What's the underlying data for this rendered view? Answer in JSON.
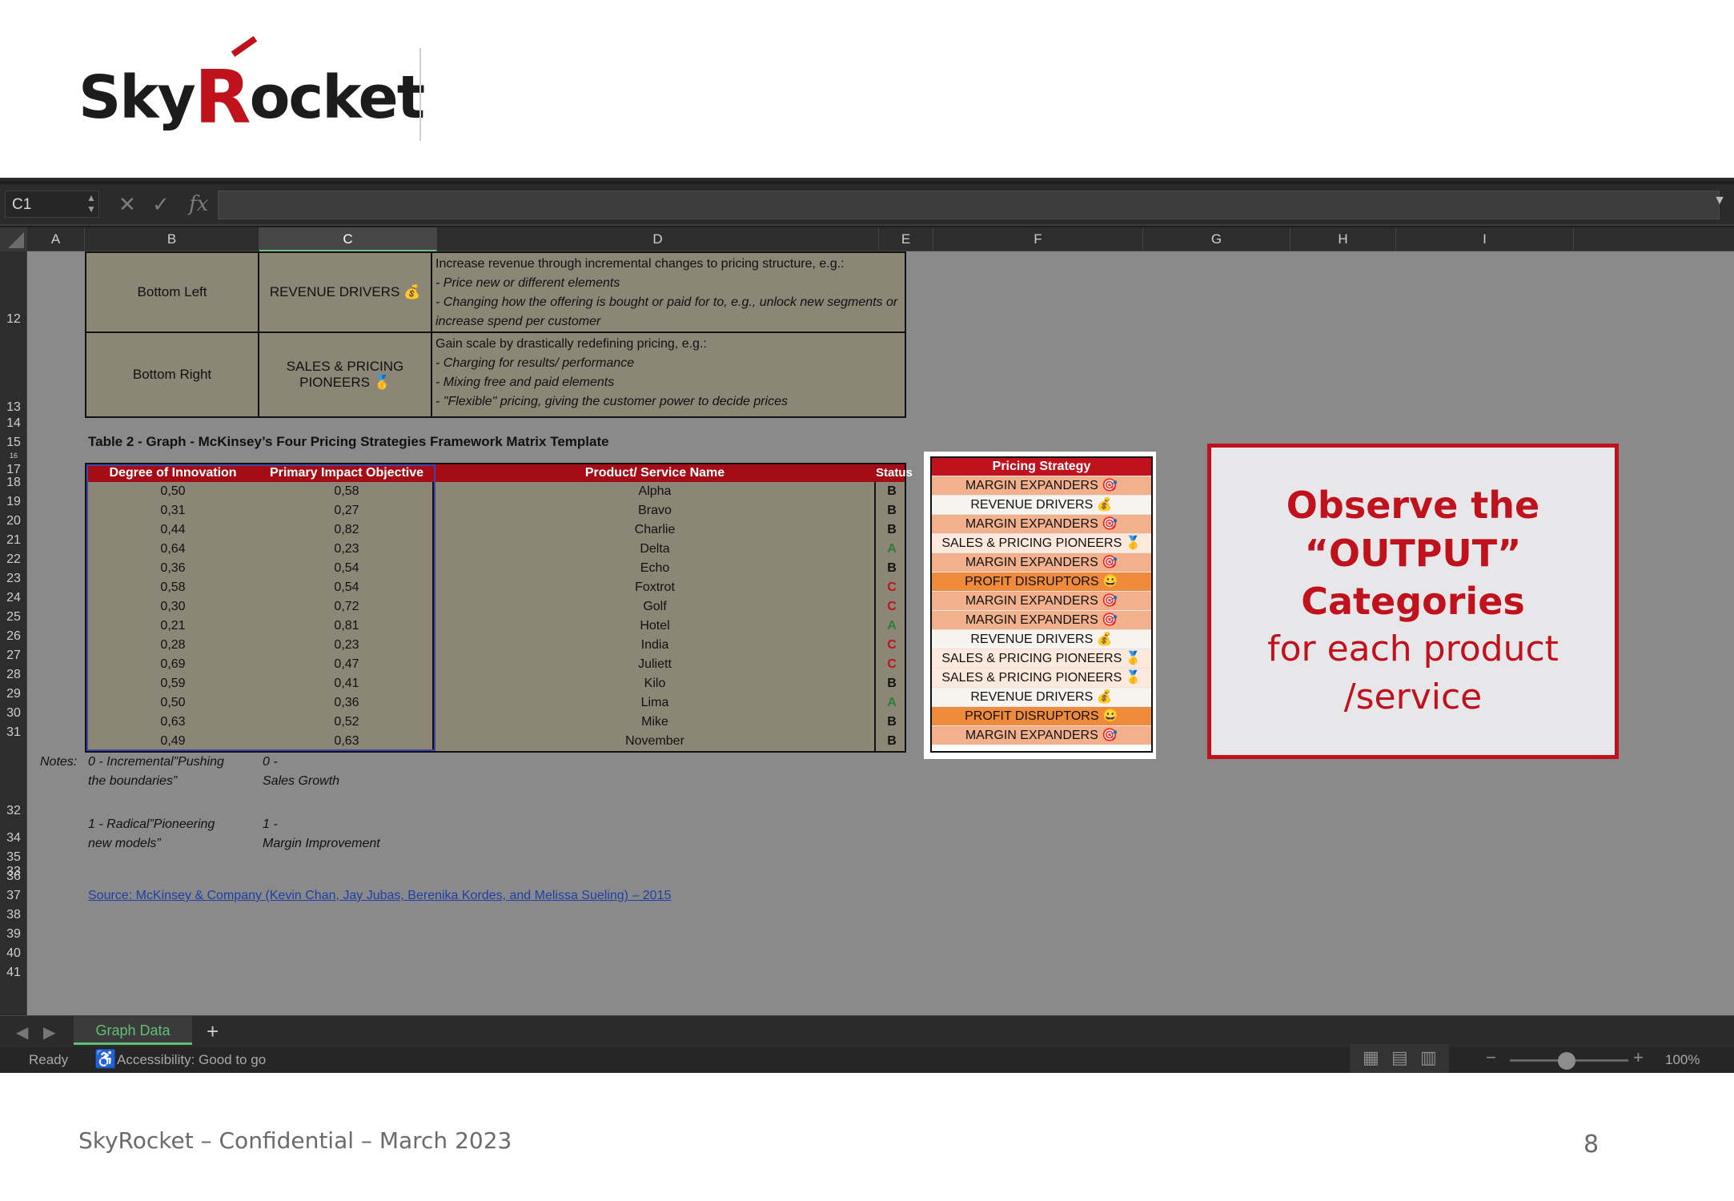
{
  "logo": {
    "part1": "Sky",
    "part2": "R",
    "part3": "ocket"
  },
  "excel": {
    "name_box": "C1",
    "columns": [
      "A",
      "B",
      "C",
      "D",
      "E",
      "F",
      "G",
      "H",
      "I"
    ],
    "rows": [
      "12",
      "13",
      "14",
      "15",
      "16",
      "17",
      "18",
      "19",
      "20",
      "21",
      "22",
      "23",
      "24",
      "25",
      "26",
      "27",
      "28",
      "29",
      "30",
      "31",
      "32",
      "33",
      "34",
      "35",
      "36",
      "37",
      "38",
      "39",
      "40",
      "41"
    ],
    "upper_rows": [
      {
        "position": "Bottom Left",
        "strategy": "REVENUE DRIVERS 💰",
        "desc_lead": "Increase revenue through incremental changes to pricing structure, e.g.:",
        "desc_items": [
          "- Price new or different elements",
          "- Changing how the offering is bought or paid for to, e.g., unlock new segments or increase spend per customer"
        ]
      },
      {
        "position": "Bottom Right",
        "strategy": "SALES & PRICING PIONEERS 🥇",
        "desc_lead": "Gain scale by drastically redefining pricing, e.g.:",
        "desc_items": [
          "- Charging for results/ performance",
          "- Mixing free and paid elements",
          "- \"Flexible\" pricing, giving the customer power to decide prices"
        ]
      }
    ],
    "table2_title": "Table 2 - Graph - McKinsey’s Four Pricing Strategies Framework Matrix Template",
    "headers": {
      "degree": "Degree of Innovation",
      "impact": "Primary Impact Objective",
      "name": "Product/ Service Name",
      "status": "Status",
      "strategy": "Pricing Strategy"
    },
    "data_rows": [
      {
        "degree": "0,50",
        "impact": "0,58",
        "name": "Alpha",
        "status": "B",
        "strategy": "MARGIN EXPANDERS 🎯"
      },
      {
        "degree": "0,31",
        "impact": "0,27",
        "name": "Bravo",
        "status": "B",
        "strategy": "REVENUE DRIVERS 💰"
      },
      {
        "degree": "0,44",
        "impact": "0,82",
        "name": "Charlie",
        "status": "B",
        "strategy": "MARGIN EXPANDERS 🎯"
      },
      {
        "degree": "0,64",
        "impact": "0,23",
        "name": "Delta",
        "status": "A",
        "strategy": "SALES & PRICING PIONEERS 🥇"
      },
      {
        "degree": "0,36",
        "impact": "0,54",
        "name": "Echo",
        "status": "B",
        "strategy": "MARGIN EXPANDERS 🎯"
      },
      {
        "degree": "0,58",
        "impact": "0,54",
        "name": "Foxtrot",
        "status": "C",
        "strategy": "PROFIT DISRUPTORS 😀"
      },
      {
        "degree": "0,30",
        "impact": "0,72",
        "name": "Golf",
        "status": "C",
        "strategy": "MARGIN EXPANDERS 🎯"
      },
      {
        "degree": "0,21",
        "impact": "0,81",
        "name": "Hotel",
        "status": "A",
        "strategy": "MARGIN EXPANDERS 🎯"
      },
      {
        "degree": "0,28",
        "impact": "0,23",
        "name": "India",
        "status": "C",
        "strategy": "REVENUE DRIVERS 💰"
      },
      {
        "degree": "0,69",
        "impact": "0,47",
        "name": "Juliett",
        "status": "C",
        "strategy": "SALES & PRICING PIONEERS 🥇"
      },
      {
        "degree": "0,59",
        "impact": "0,41",
        "name": "Kilo",
        "status": "B",
        "strategy": "SALES & PRICING PIONEERS 🥇"
      },
      {
        "degree": "0,50",
        "impact": "0,36",
        "name": "Lima",
        "status": "A",
        "strategy": "REVENUE DRIVERS 💰"
      },
      {
        "degree": "0,63",
        "impact": "0,52",
        "name": "Mike",
        "status": "B",
        "strategy": "PROFIT DISRUPTORS 😀"
      },
      {
        "degree": "0,49",
        "impact": "0,63",
        "name": "November",
        "status": "B",
        "strategy": "MARGIN EXPANDERS 🎯"
      }
    ],
    "strategy_colors": {
      "MARGIN EXPANDERS": "#f2b08c",
      "REVENUE DRIVERS": "#f7f3ee",
      "SALES & PRICING PIONEERS": "#fde9dc",
      "PROFIT DISRUPTORS": "#ee8a3a"
    },
    "status_colors": {
      "A": "#2e7d3a",
      "B": "#111111",
      "C": "#c0121c"
    },
    "notes": {
      "label": "Notes:",
      "deg0": "0 - Incremental”Pushing",
      "deg0b": "the boundaries”",
      "imp0": "0 -",
      "imp0b": "Sales Growth",
      "deg1": "1 - Radical”Pioneering",
      "deg1b": "new models”",
      "imp1": "1 -",
      "imp1b": "Margin Improvement"
    },
    "source": "Source: McKinsey & Company (Kevin Chan, Jay Jubas, Berenika Kordes, and Melissa Sueling) – 2015",
    "sheet_tab": "Graph Data",
    "status_ready": "Ready",
    "accessibility": "Accessibility: Good to go",
    "zoom": "100%"
  },
  "callout": {
    "line1": "Observe the",
    "line2": "“OUTPUT” Categories",
    "line3": "for each product",
    "line4": "/service"
  },
  "footer": {
    "text": "SkyRocket – Confidential – March 2023",
    "page": "8"
  }
}
